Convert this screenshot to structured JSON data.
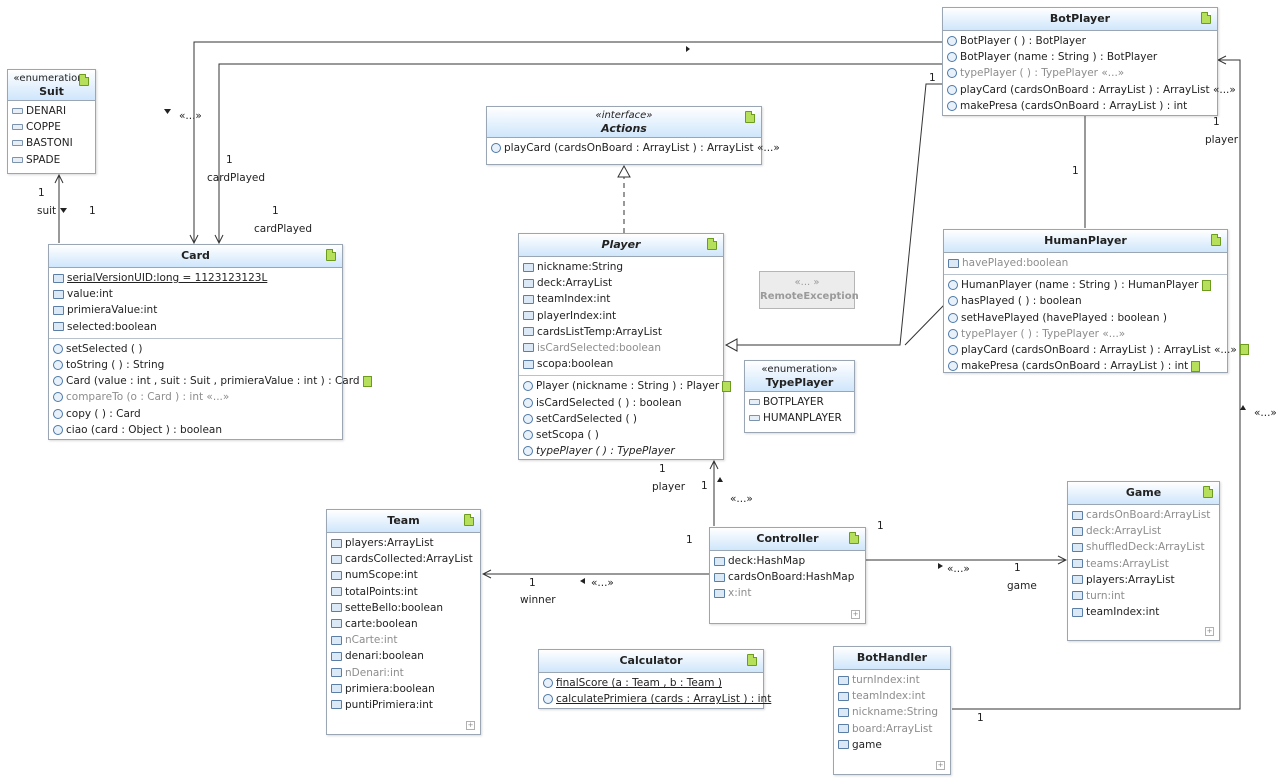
{
  "classes": {
    "suit": {
      "stereotype": "«enumeration»",
      "name": "Suit",
      "literals": [
        "DENARI",
        "COPPE",
        "BASTONI",
        "SPADE"
      ]
    },
    "card": {
      "name": "Card",
      "attributes": [
        "serialVersionUID:long = 1123123123L",
        "value:int",
        "primieraValue:int",
        "selected:boolean"
      ],
      "methods": [
        "setSelected ( )",
        "toString ( ) : String",
        "Card (value : int , suit : Suit , primieraValue : int ) : Card",
        "compareTo (o : Card ) : int «...»",
        "copy ( ) : Card",
        "ciao (card : Object ) : boolean"
      ]
    },
    "actions": {
      "stereotype": "«interface»",
      "name": "Actions",
      "methods": [
        "playCard (cardsOnBoard : ArrayList ) : ArrayList «...»"
      ]
    },
    "player": {
      "name": "Player",
      "attributes": [
        "nickname:String",
        "deck:ArrayList",
        "teamIndex:int",
        "playerIndex:int",
        "cardsListTemp:ArrayList",
        "isCardSelected:boolean",
        "scopa:boolean"
      ],
      "methods": [
        "Player (nickname : String ) : Player",
        "isCardSelected ( ) : boolean",
        "setCardSelected ( )",
        "setScopa ( )",
        "typePlayer ( ) : TypePlayer"
      ]
    },
    "botplayer": {
      "name": "BotPlayer",
      "methods": [
        "BotPlayer ( ) : BotPlayer",
        "BotPlayer (name : String ) : BotPlayer",
        "typePlayer ( ) : TypePlayer «...»",
        "playCard (cardsOnBoard : ArrayList ) : ArrayList «...»",
        "makePresa (cardsOnBoard : ArrayList ) : int"
      ]
    },
    "humanplayer": {
      "name": "HumanPlayer",
      "attributes": [
        "havePlayed:boolean"
      ],
      "methods": [
        "HumanPlayer (name : String ) : HumanPlayer",
        "hasPlayed ( ) : boolean",
        "setHavePlayed (havePlayed : boolean )",
        "typePlayer ( ) : TypePlayer «...»",
        "playCard (cardsOnBoard : ArrayList ) : ArrayList «...»",
        "makePresa (cardsOnBoard : ArrayList ) : int"
      ]
    },
    "remote": {
      "stereotype": "«... »",
      "name": "RemoteException"
    },
    "typeplayer": {
      "stereotype": "«enumeration»",
      "name": "TypePlayer",
      "literals": [
        "BOTPLAYER",
        "HUMANPLAYER"
      ]
    },
    "team": {
      "name": "Team",
      "attributes": [
        "players:ArrayList",
        "cardsCollected:ArrayList",
        "numScope:int",
        "totalPoints:int",
        "setteBello:boolean",
        "carte:boolean",
        "nCarte:int",
        "denari:boolean",
        "nDenari:int",
        "primiera:boolean",
        "puntiPrimiera:int"
      ]
    },
    "controller": {
      "name": "Controller",
      "attributes": [
        "deck:HashMap",
        "cardsOnBoard:HashMap",
        "x:int"
      ]
    },
    "calculator": {
      "name": "Calculator",
      "methods": [
        "finalScore (a : Team , b : Team )",
        "calculatePrimiera (cards : ArrayList ) : int"
      ]
    },
    "game": {
      "name": "Game",
      "attributes": [
        "cardsOnBoard:ArrayList",
        "deck:ArrayList",
        "shuffledDeck:ArrayList",
        "teams:ArrayList",
        "players:ArrayList",
        "turn:int",
        "teamIndex:int"
      ]
    },
    "bothandler": {
      "name": "BotHandler",
      "attributes": [
        "turnIndex:int",
        "teamIndex:int",
        "nickname:String",
        "board:ArrayList",
        "game"
      ]
    }
  },
  "labels": {
    "one": "1",
    "suit": "suit",
    "cardPlayed": "cardPlayed",
    "player": "player",
    "winner": "winner",
    "game": "game",
    "ellipsis": "«...»",
    "arrow_right": "▸",
    "arrow_down": "▾",
    "arrow_up": "▴",
    "arrow_left": "◂"
  },
  "colors": {
    "header_top": "#ffffff",
    "header_bottom": "#cfe6fb",
    "border": "#9aa6b4",
    "line": "#333333"
  }
}
